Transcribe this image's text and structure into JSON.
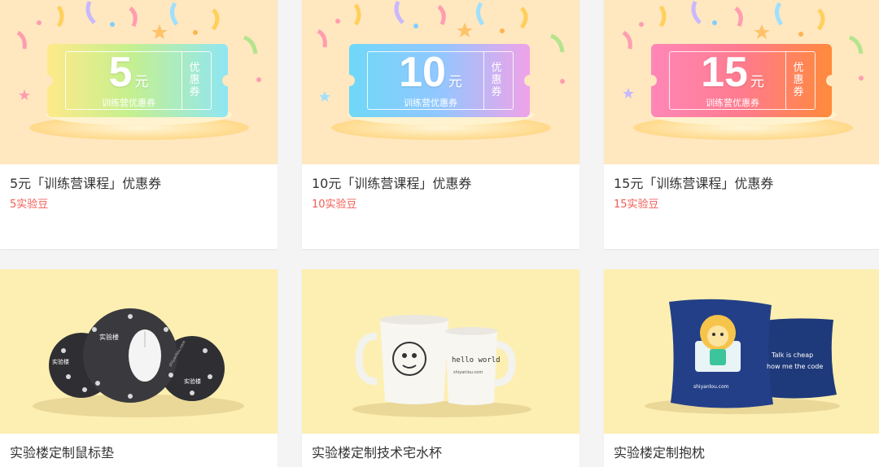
{
  "products": [
    {
      "title": "5元「训练营课程」优惠券",
      "price": "5实验豆",
      "coupon": {
        "amount": "5",
        "unit": "元",
        "caption": "训练营优惠券",
        "side_label": "优惠券"
      }
    },
    {
      "title": "10元「训练营课程」优惠券",
      "price": "10实验豆",
      "coupon": {
        "amount": "10",
        "unit": "元",
        "caption": "训练营优惠券",
        "side_label": "优惠券"
      }
    },
    {
      "title": "15元「训练营课程」优惠券",
      "price": "15实验豆",
      "coupon": {
        "amount": "15",
        "unit": "元",
        "caption": "训练营优惠券",
        "side_label": "优惠券"
      }
    },
    {
      "title": "实验楼定制鼠标垫",
      "image_texts": [
        "实验楼",
        "实验楼",
        "实验楼",
        "shiyanlou.com"
      ]
    },
    {
      "title": "实验楼定制技术宅水杯",
      "image_texts": [
        "hello world",
        "shiyanlou.com"
      ]
    },
    {
      "title": "实验楼定制抱枕",
      "image_texts": [
        "shiyanlou.com",
        "Talk is cheap",
        "how me the code"
      ]
    }
  ],
  "colors": {
    "price": "#f25c54",
    "title": "#333333",
    "coupon_background": "#ffe7c0",
    "merch_background": "#fdefb2"
  }
}
